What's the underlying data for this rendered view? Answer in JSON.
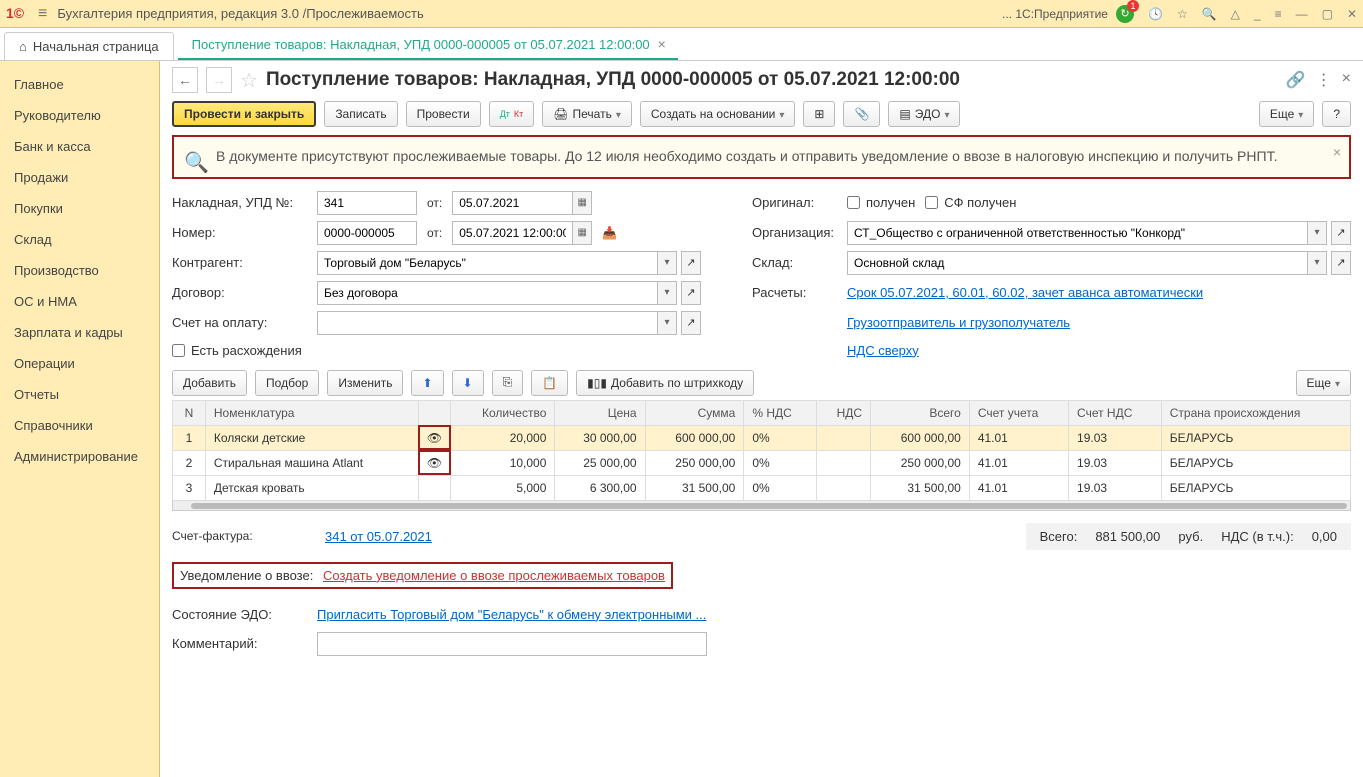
{
  "app": {
    "title": "Бухгалтерия предприятия, редакция 3.0 /Прослеживаемость",
    "platform": "... 1С:Предприятие"
  },
  "tabs": {
    "home": "Начальная страница",
    "doc": "Поступление товаров: Накладная, УПД 0000-000005 от 05.07.2021 12:00:00"
  },
  "sidebar": [
    "Главное",
    "Руководителю",
    "Банк и касса",
    "Продажи",
    "Покупки",
    "Склад",
    "Производство",
    "ОС и НМА",
    "Зарплата и кадры",
    "Операции",
    "Отчеты",
    "Справочники",
    "Администрирование"
  ],
  "doc": {
    "title": "Поступление товаров: Накладная, УПД 0000-000005 от 05.07.2021 12:00:00",
    "toolbar": {
      "post_close": "Провести и закрыть",
      "write": "Записать",
      "post": "Провести",
      "print": "Печать",
      "create_based": "Создать на основании",
      "edo": "ЭДО",
      "more": "Еще"
    },
    "notice": "В документе присутствуют прослеживаемые товары. До 12 июля необходимо создать и отправить уведомление о ввозе в налоговую инспекцию и получить РНПТ.",
    "fields": {
      "invoice_label": "Накладная, УПД №:",
      "invoice_no": "341",
      "from_label": "от:",
      "invoice_date": "05.07.2021",
      "number_label": "Номер:",
      "number": "0000-000005",
      "datetime": "05.07.2021 12:00:00",
      "original_label": "Оригинал:",
      "received": "получен",
      "sf_received": "СФ получен",
      "org_label": "Организация:",
      "org": "СТ_Общество с ограниченной ответственностью \"Конкорд\"",
      "counterparty_label": "Контрагент:",
      "counterparty": "Торговый дом \"Беларусь\"",
      "warehouse_label": "Склад:",
      "warehouse": "Основной склад",
      "contract_label": "Договор:",
      "contract": "Без договора",
      "calc_label": "Расчеты:",
      "calc_link": "Срок 05.07.2021, 60.01, 60.02, зачет аванса автоматически",
      "pay_invoice_label": "Счет на оплату:",
      "shipper_link": "Грузоотправитель и грузополучатель",
      "vat_link": "НДС сверху",
      "discrepancy": "Есть расхождения"
    },
    "tabletb": {
      "add": "Добавить",
      "pick": "Подбор",
      "edit": "Изменить",
      "barcode": "Добавить по штрихкоду",
      "more": "Еще"
    },
    "columns": [
      "N",
      "Номенклатура",
      "",
      "Количество",
      "Цена",
      "Сумма",
      "% НДС",
      "НДС",
      "Всего",
      "Счет учета",
      "Счет НДС",
      "Страна происхождения"
    ],
    "rows": [
      {
        "n": "1",
        "name": "Коляски детские",
        "eye": true,
        "qty": "20,000",
        "price": "30 000,00",
        "sum": "600 000,00",
        "vatp": "0%",
        "vat": "",
        "total": "600 000,00",
        "acc": "41.01",
        "vatacc": "19.03",
        "country": "БЕЛАРУСЬ"
      },
      {
        "n": "2",
        "name": "Стиральная машина Atlant",
        "eye": true,
        "qty": "10,000",
        "price": "25 000,00",
        "sum": "250 000,00",
        "vatp": "0%",
        "vat": "",
        "total": "250 000,00",
        "acc": "41.01",
        "vatacc": "19.03",
        "country": "БЕЛАРУСЬ"
      },
      {
        "n": "3",
        "name": "Детская кровать",
        "eye": false,
        "qty": "5,000",
        "price": "6 300,00",
        "sum": "31 500,00",
        "vatp": "0%",
        "vat": "",
        "total": "31 500,00",
        "acc": "41.01",
        "vatacc": "19.03",
        "country": "БЕЛАРУСЬ"
      }
    ],
    "totals": {
      "sf_label": "Счет-фактура:",
      "sf_link": "341 от 05.07.2021",
      "total_label": "Всего:",
      "total": "881 500,00",
      "cur": "руб.",
      "vat_label": "НДС (в т.ч.):",
      "vat": "0,00"
    },
    "footer": {
      "import_label": "Уведомление о ввозе:",
      "import_link": "Создать уведомление о ввозе прослеживаемых товаров",
      "edo_label": "Состояние ЭДО:",
      "edo_link": "Пригласить Торговый дом \"Беларусь\" к обмену электронными ...",
      "comment_label": "Комментарий:"
    }
  }
}
